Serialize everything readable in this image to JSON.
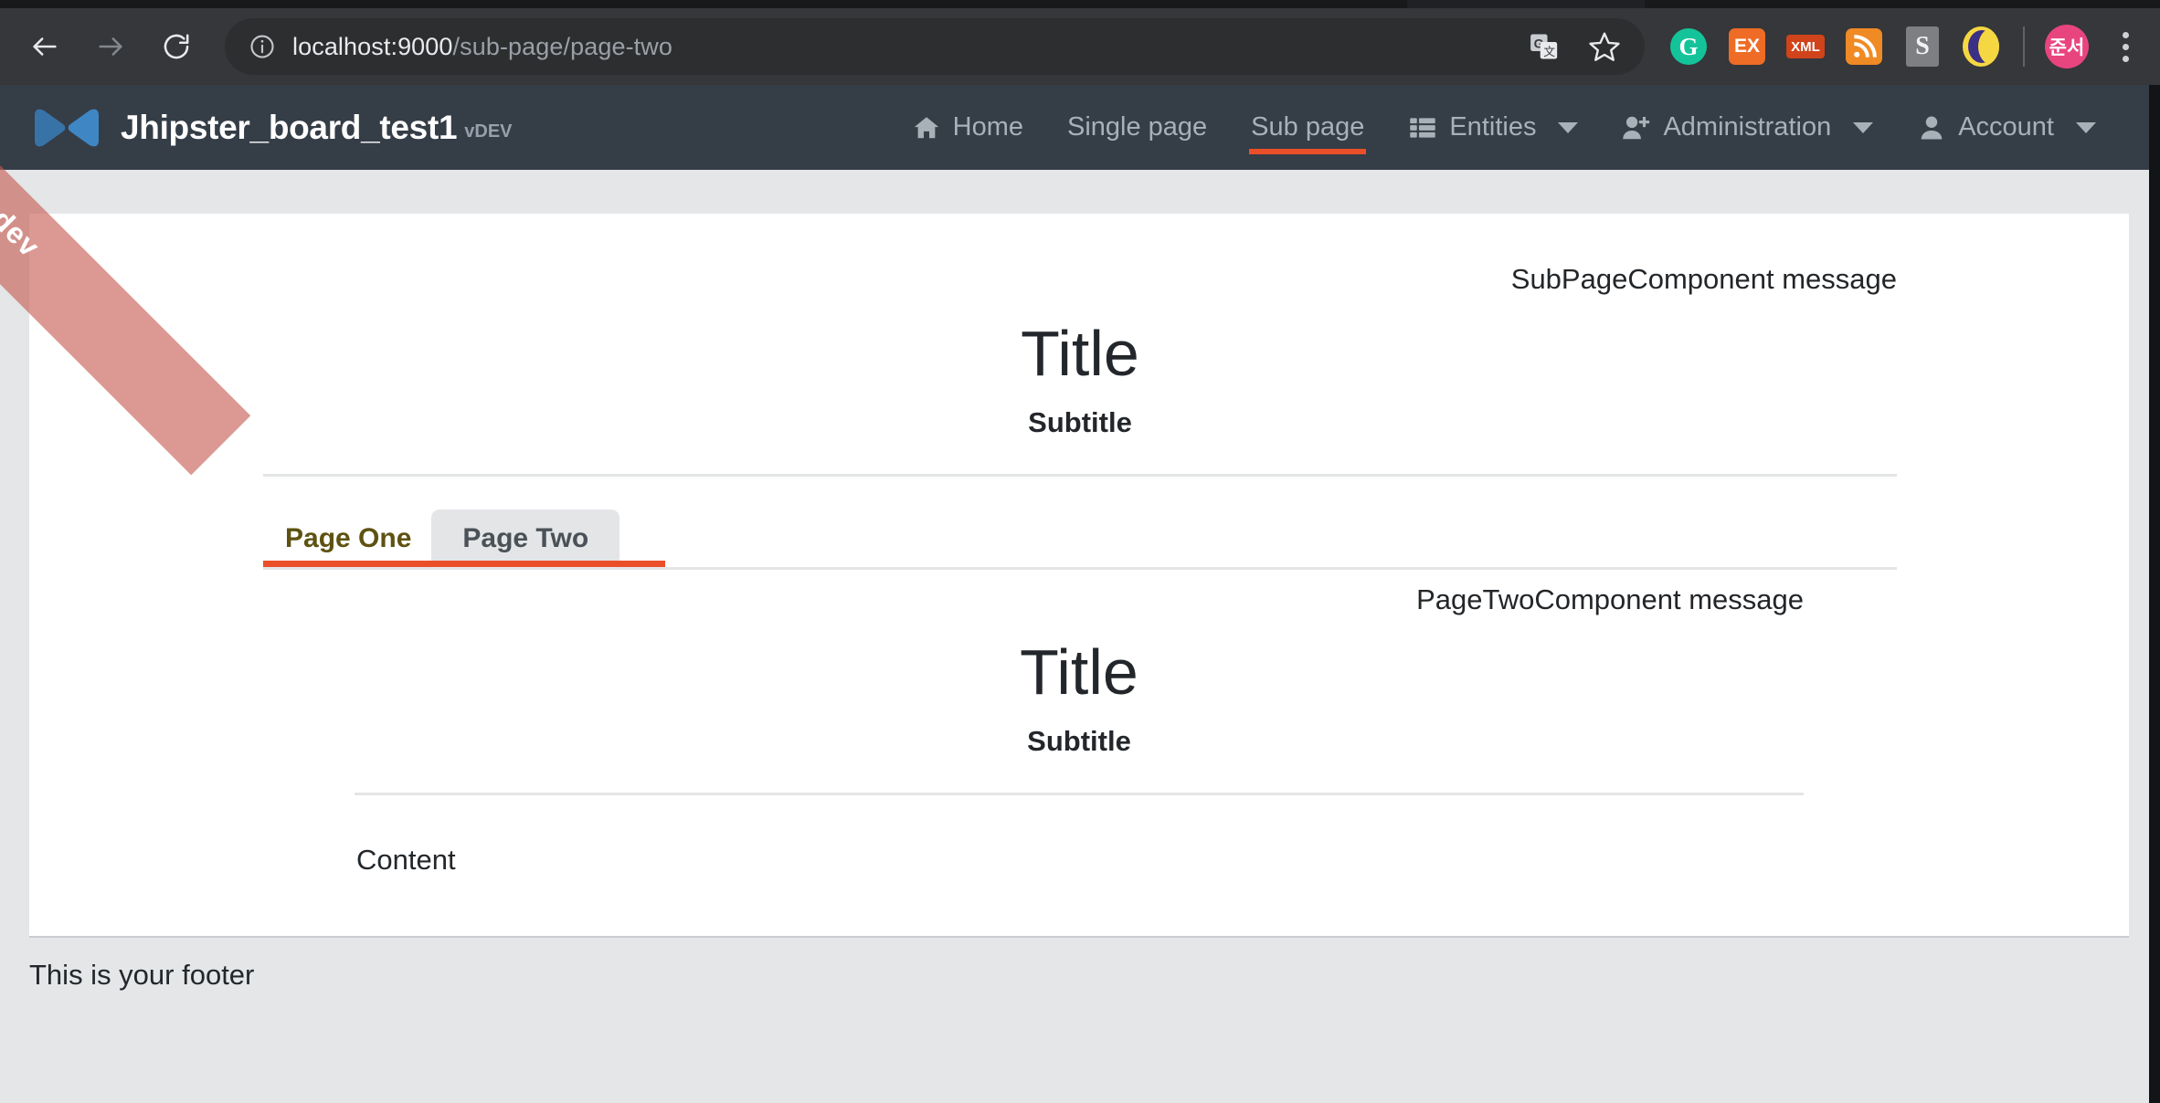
{
  "browser": {
    "back_label": "Back",
    "forward_label": "Forward",
    "reload_label": "Reload",
    "url_host": "localhost:9000",
    "url_path": "/sub-page/page-two",
    "url_full": "localhost:9000/sub-page/page-two",
    "site_info_label": "View site information",
    "extensions": [
      {
        "name": "translate-icon",
        "label": "G"
      },
      {
        "name": "bookmark-star-icon",
        "label": ""
      },
      {
        "name": "grammarly-extension-icon",
        "label": "G"
      },
      {
        "name": "ex-extension-icon",
        "label": "EX"
      },
      {
        "name": "xml-extension-icon",
        "label": "XML"
      },
      {
        "name": "rss-extension-icon",
        "label": ""
      },
      {
        "name": "s-extension-icon",
        "label": "S"
      },
      {
        "name": "dark-mode-extension-icon",
        "label": ""
      },
      {
        "name": "profile-avatar",
        "label": "준서"
      },
      {
        "name": "chrome-menu-icon",
        "label": ""
      }
    ],
    "avatar_initials": "준서"
  },
  "navbar": {
    "brand_name": "Jhipster_board_test1",
    "brand_version": "vDEV",
    "ribbon_label": "dev",
    "items": [
      {
        "label": "Home",
        "icon": "home-icon",
        "active": false,
        "caret": false
      },
      {
        "label": "Single page",
        "icon": "",
        "active": false,
        "caret": false
      },
      {
        "label": "Sub page",
        "icon": "",
        "active": true,
        "caret": false
      },
      {
        "label": "Entities",
        "icon": "th-list-icon",
        "active": false,
        "caret": true
      },
      {
        "label": "Administration",
        "icon": "user-plus-icon",
        "active": false,
        "caret": true
      },
      {
        "label": "Account",
        "icon": "user-icon",
        "active": false,
        "caret": true
      }
    ],
    "accent_color": "#ea4f2a",
    "background_color": "#353d47"
  },
  "main": {
    "sub_page": {
      "message": "SubPageComponent message",
      "title": "Title",
      "subtitle": "Subtitle"
    },
    "tabs": [
      {
        "label": "Page One",
        "active": false
      },
      {
        "label": "Page Two",
        "active": true
      }
    ],
    "page_two": {
      "message": "PageTwoComponent message",
      "title": "Title",
      "subtitle": "Subtitle",
      "content": "Content"
    }
  },
  "footer": {
    "text": "This is your footer"
  }
}
